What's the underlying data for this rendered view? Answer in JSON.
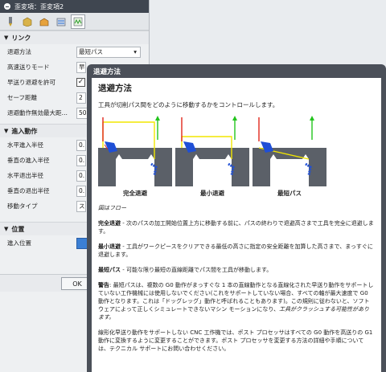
{
  "dialog": {
    "title": "歪変項：歪変項2",
    "sections": {
      "link": {
        "heading": "リンク",
        "rows": [
          {
            "label": "退避方法",
            "value": "最短パス"
          },
          {
            "label": "高速送りモード",
            "value": "早"
          },
          {
            "label": "早送り退避を許可",
            "checked": "✓"
          },
          {
            "label": "セーフ距離",
            "value": "2"
          },
          {
            "label": "退避動作無効最大距…",
            "value": "50"
          }
        ]
      },
      "approach": {
        "heading": "進入動作",
        "rows": [
          {
            "label": "水平進入半径",
            "value": "0."
          },
          {
            "label": "垂直の進入半径",
            "value": "0."
          },
          {
            "label": "水平退出半径",
            "value": "0."
          },
          {
            "label": "垂直の退出半径",
            "value": "0."
          },
          {
            "label": "移動タイプ",
            "value": "ス"
          }
        ]
      },
      "position": {
        "heading": "位置",
        "rows": [
          {
            "label": "進入位置"
          }
        ]
      }
    },
    "ok_label": "OK"
  },
  "help": {
    "title": "退避方法",
    "heading": "退避方法",
    "lead": "工具が切削パス間をどのように移動するかをコントロールします。",
    "figures": [
      {
        "caption": "完全退避"
      },
      {
        "caption": "最小退避"
      },
      {
        "caption": "最短パス"
      }
    ],
    "figure_note": "図はフロー",
    "p1_term": "完全退避",
    "p1_text": " - 次のパスの加工開始位置上方に移動する前に、パスの終わりで退避高さまで工具を完全に退避します。",
    "p2_term": "最小退避",
    "p2_text": " - 工具がワークピースをクリアできる最低の高さに指定の安全距離を加算した高さまで、まっすぐに退避します。",
    "p3_term": "最短パス",
    "p3_text": " - 可能な限り最短の直線距離でパス間を工具が移動します。",
    "p4_term": "警告",
    "p4_text": ": 最短パスは、複数の G0 動作がまっすぐな 1 本の直線動作となる直線化された早送り動作をサポートしていない工作機械には使用しないでください(これをサポートしていない場合、すべての軸が最大速度で G0 動作となります。これは「ドッグレッグ」動作と呼ばれることもあります)。この規則に従わないと、ソフトウェアによって正しくシミュレートできないマシン モーションになり、",
    "p4_italic": "工具がクラッシュする可能性があります。",
    "p5_text": "線形化早送り動作をサポートしない CNC 工作機では、ポスト プロセッサはすべての G0 動作を高送りの G1 動作に変換するように変更することができます。ポスト プロセッサを変更する方法の詳細や手順については、テクニカル サポートにお問い合わせください。",
    "colors": {
      "path": "#f2e600",
      "arrow": "#22c41c",
      "tool": "#1f4fd6",
      "stock": "#5b6068",
      "tool_red": "#e0261c"
    }
  }
}
